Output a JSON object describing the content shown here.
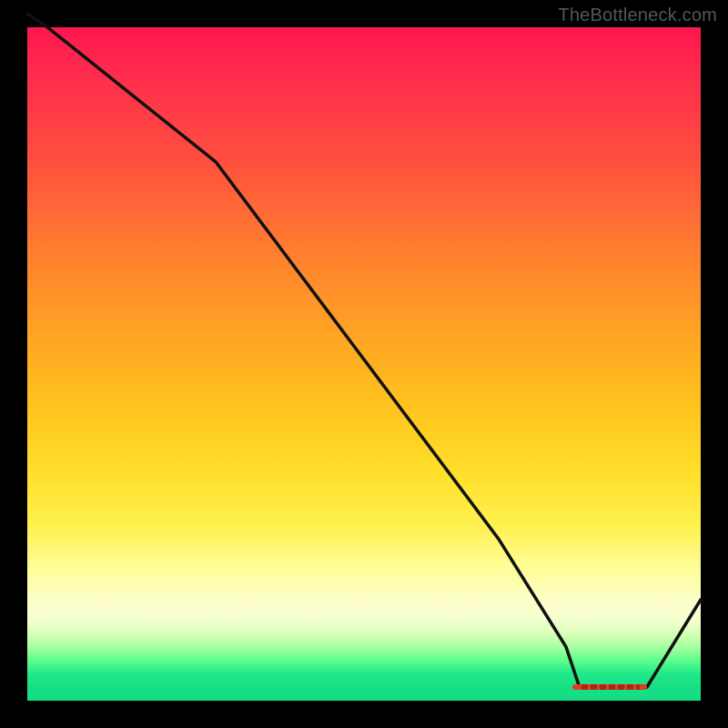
{
  "watermark": "TheBottleneck.com",
  "chart_data": {
    "type": "line",
    "x": [
      0.0,
      0.03,
      0.28,
      0.4,
      0.55,
      0.7,
      0.8,
      0.82,
      0.9,
      0.92,
      1.0
    ],
    "y": [
      1.02,
      1.0,
      0.8,
      0.64,
      0.44,
      0.24,
      0.08,
      0.02,
      0.02,
      0.02,
      0.15
    ],
    "flat_min": {
      "x_start": 0.81,
      "x_end": 0.92,
      "y": 0.02
    },
    "xlim": [
      0,
      1
    ],
    "ylim": [
      0,
      1
    ],
    "xlabel": "",
    "ylabel": "",
    "title": "",
    "annotations": {
      "background": "vertical heatmap red→orange→yellow→green",
      "valley_segment": "dashed red marker along the flat minimum"
    },
    "colors": {
      "curve": "#101010",
      "flat_marker": "#e63b1e",
      "frame": "#000000",
      "grad_top": "#ff1650",
      "grad_bottom": "#15dd84"
    }
  }
}
